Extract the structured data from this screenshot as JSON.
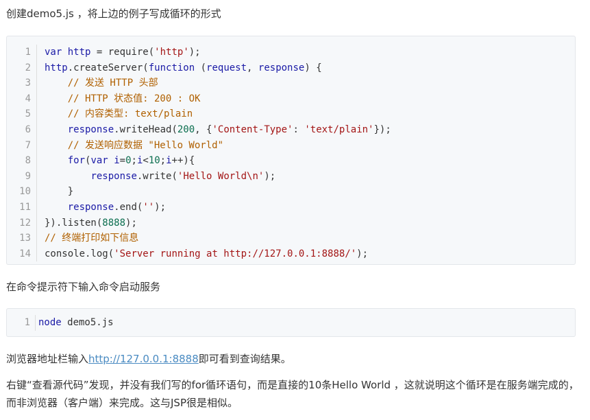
{
  "intro_text": "创建demo5.js ，将上边的例子写成循环的形式",
  "code_block_1": {
    "lines": [
      {
        "n": "1",
        "html": "var http = require('http');"
      },
      {
        "n": "2",
        "html": "http.createServer(function (request, response) {"
      },
      {
        "n": "3",
        "html": "    // 发送 HTTP 头部"
      },
      {
        "n": "4",
        "html": "    // HTTP 状态值: 200 : OK"
      },
      {
        "n": "5",
        "html": "    // 内容类型: text/plain"
      },
      {
        "n": "6",
        "html": "    response.writeHead(200, {'Content-Type': 'text/plain'});"
      },
      {
        "n": "7",
        "html": "    // 发送响应数据 \"Hello World\""
      },
      {
        "n": "8",
        "html": "    for(var i=0;i<10;i++){"
      },
      {
        "n": "9",
        "html": "        response.write('Hello World\\n');"
      },
      {
        "n": "10",
        "html": "    }"
      },
      {
        "n": "11",
        "html": "    response.end('');"
      },
      {
        "n": "12",
        "html": "}).listen(8888);"
      },
      {
        "n": "13",
        "html": "// 终端打印如下信息"
      },
      {
        "n": "14",
        "html": "console.log('Server running at http://127.0.0.1:8888/');"
      }
    ]
  },
  "start_text": "在命令提示符下输入命令启动服务",
  "code_block_2": {
    "lines": [
      {
        "n": "1",
        "html": "node demo5.js"
      }
    ]
  },
  "browser_text_prefix": "浏览器地址栏输入",
  "browser_link": "http://127.0.0.1:8888",
  "browser_text_suffix": "即可看到查询结果。",
  "conclusion_text": "右键“查看源代码”发现，并没有我们写的for循环语句，而是直接的10条Hello World ，这就说明这个循环是在服务端完成的，而非浏览器（客户端）来完成。这与JSP很是相似。",
  "colors": {
    "keyword": "#1a1aa6",
    "string": "#a31515",
    "comment": "#b06000",
    "number": "#0b6e4f",
    "plain": "#333333",
    "link": "#4a8bc2",
    "code_bg": "#f6f8fa"
  }
}
